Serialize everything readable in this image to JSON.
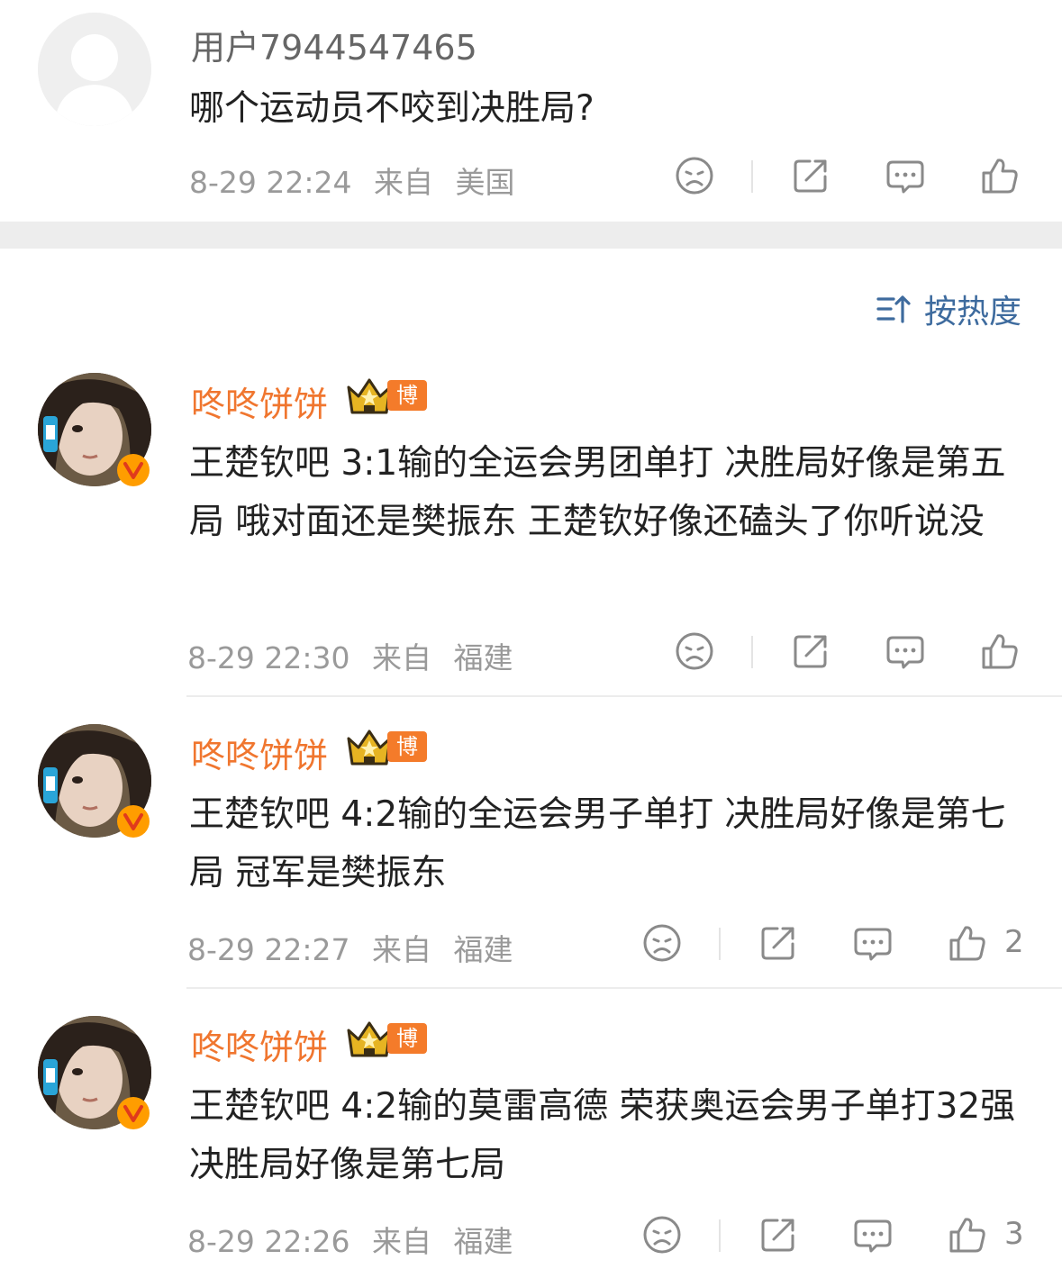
{
  "post": {
    "username": "用户7944547465",
    "text": "哪个运动员不咬到决胜局?",
    "time": "8-29 22:24",
    "from_label": "来自",
    "location": "美国"
  },
  "sort": {
    "label": "按热度"
  },
  "comments": [
    {
      "username": "咚咚饼饼",
      "badge": "博主",
      "text": "王楚钦吧 3:1输的全运会男团单打 决胜局好像是第五局 哦对面还是樊振东 王楚钦好像还磕头了你听说没",
      "time": "8-29 22:30",
      "from_label": "来自",
      "location": "福建",
      "likes": ""
    },
    {
      "username": "咚咚饼饼",
      "badge": "博主",
      "text": "王楚钦吧 4:2输的全运会男子单打 决胜局好像是第七局 冠军是樊振东",
      "time": "8-29 22:27",
      "from_label": "来自",
      "location": "福建",
      "likes": "2"
    },
    {
      "username": "咚咚饼饼",
      "badge": "博主",
      "text": "王楚钦吧 4:2输的莫雷高德 荣获奥运会男子单打32强 决胜局好像是第七局",
      "time": "8-29 22:26",
      "from_label": "来自",
      "location": "福建",
      "likes": "3"
    }
  ],
  "colors": {
    "username_accent": "#f0762f",
    "sort_accent": "#3e6b9e",
    "meta": "#9a9a9a",
    "icon": "#8a8a8a"
  },
  "icons": [
    "sad-face-icon",
    "share-icon",
    "comment-bubble-icon",
    "thumbs-up-icon",
    "sort-icon",
    "crown-icon",
    "verified-icon"
  ]
}
